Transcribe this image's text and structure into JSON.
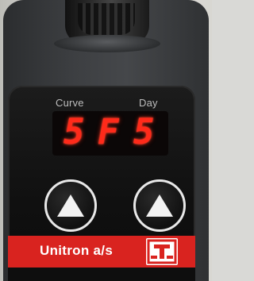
{
  "panel": {
    "curve_label": "Curve",
    "day_label": "Day"
  },
  "display": {
    "digit1": "5",
    "digit2": "F",
    "digit3": "5",
    "color": "#ff2a1a"
  },
  "buttons": {
    "curve_up_icon": "triangle-up-icon",
    "day_up_icon": "triangle-up-icon"
  },
  "brand": {
    "name": "Unitron a/s",
    "strip_color": "#d9231f",
    "logo_icon": "unitron-logo-icon"
  }
}
